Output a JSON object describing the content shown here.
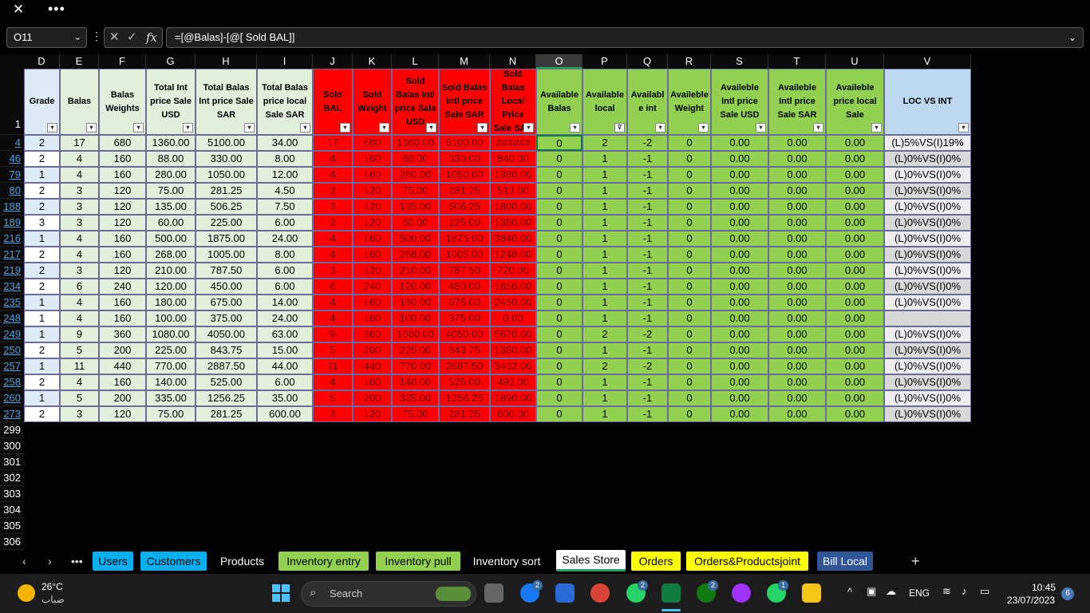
{
  "window": {
    "close_icon": "close-icon",
    "more_icon": "more-icon"
  },
  "formula_bar": {
    "cell_ref": "O11",
    "formula": "=[@Balas]-[@[ Sold BAL]]",
    "fx_label": "fx"
  },
  "columns": [
    {
      "letter": "D",
      "header": "Grade",
      "fill": "#ddebf7"
    },
    {
      "letter": "E",
      "header": "Balas",
      "fill": "#e2efda"
    },
    {
      "letter": "F",
      "header": "Balas Weights",
      "fill": "#e2efda"
    },
    {
      "letter": "G",
      "header": "Total Int price Sale USD",
      "fill": "#e2efda"
    },
    {
      "letter": "H",
      "header": "Total Balas Int price Sale SAR",
      "fill": "#e2efda"
    },
    {
      "letter": "I",
      "header": "Total Balas price local Sale SAR",
      "fill": "#e2efda"
    },
    {
      "letter": "J",
      "header": "Sold BAL",
      "fill": "#ff0000"
    },
    {
      "letter": "K",
      "header": "Sold Weight",
      "fill": "#ff0000"
    },
    {
      "letter": "L",
      "header": "Sold Balas Intl price Sale USD",
      "fill": "#ff0000"
    },
    {
      "letter": "M",
      "header": "Sold Balas Intl price Sale SAR",
      "fill": "#ff0000"
    },
    {
      "letter": "N",
      "header": "Sold Balas Local Price Sale SAR",
      "fill": "#ff0000"
    },
    {
      "letter": "O",
      "header": "Available Balas",
      "fill": "#92d050"
    },
    {
      "letter": "P",
      "header": "Available local",
      "fill": "#92d050"
    },
    {
      "letter": "Q",
      "header": "Availabl e int",
      "fill": "#92d050"
    },
    {
      "letter": "R",
      "header": "Availeble Weight",
      "fill": "#92d050"
    },
    {
      "letter": "S",
      "header": "Availeble Intl price Sale USD",
      "fill": "#92d050"
    },
    {
      "letter": "T",
      "header": "Availeble Intl price Sale SAR",
      "fill": "#92d050"
    },
    {
      "letter": "U",
      "header": "Availeble price local Sale",
      "fill": "#92d050"
    },
    {
      "letter": "V",
      "header": "LOC VS INT",
      "fill": "#bdd7ee"
    }
  ],
  "header_row_number": "1",
  "rows": [
    {
      "n": "4",
      "c": [
        "2",
        "17",
        "680",
        "1360.00",
        "5100.00",
        "34.00",
        "17",
        "680",
        "1360.00",
        "5100.00",
        "######",
        "0",
        "2",
        "-2",
        "0",
        "0.00",
        "0.00",
        "0.00",
        "(L)5%VS(I)19%"
      ]
    },
    {
      "n": "46",
      "c": [
        "2",
        "4",
        "160",
        "88.00",
        "330.00",
        "8.00",
        "4",
        "160",
        "88.00",
        "330.00",
        "840.00",
        "0",
        "1",
        "-1",
        "0",
        "0.00",
        "0.00",
        "0.00",
        "(L)0%VS(I)0%"
      ]
    },
    {
      "n": "79",
      "c": [
        "1",
        "4",
        "160",
        "280.00",
        "1050.00",
        "12.00",
        "4",
        "160",
        "280.00",
        "1050.00",
        "1380.00",
        "0",
        "1",
        "-1",
        "0",
        "0.00",
        "0.00",
        "0.00",
        "(L)0%VS(I)0%"
      ]
    },
    {
      "n": "80",
      "c": [
        "2",
        "3",
        "120",
        "75.00",
        "281.25",
        "4.50",
        "3",
        "120",
        "75.00",
        "281.25",
        "513.00",
        "0",
        "1",
        "-1",
        "0",
        "0.00",
        "0.00",
        "0.00",
        "(L)0%VS(I)0%"
      ]
    },
    {
      "n": "188",
      "c": [
        "2",
        "3",
        "120",
        "135.00",
        "506.25",
        "7.50",
        "3",
        "120",
        "135.00",
        "506.25",
        "1800.00",
        "0",
        "1",
        "-1",
        "0",
        "0.00",
        "0.00",
        "0.00",
        "(L)0%VS(I)0%"
      ]
    },
    {
      "n": "189",
      "c": [
        "3",
        "3",
        "120",
        "60.00",
        "225.00",
        "6.00",
        "3",
        "120",
        "60.00",
        "225.00",
        "1380.00",
        "0",
        "1",
        "-1",
        "0",
        "0.00",
        "0.00",
        "0.00",
        "(L)0%VS(I)0%"
      ]
    },
    {
      "n": "216",
      "c": [
        "1",
        "4",
        "160",
        "500.00",
        "1875.00",
        "24.00",
        "4",
        "160",
        "500.00",
        "1875.00",
        "3840.00",
        "0",
        "1",
        "-1",
        "0",
        "0.00",
        "0.00",
        "0.00",
        "(L)0%VS(I)0%"
      ]
    },
    {
      "n": "217",
      "c": [
        "2",
        "4",
        "160",
        "268.00",
        "1005.00",
        "8.00",
        "4",
        "160",
        "268.00",
        "1005.00",
        "1248.00",
        "0",
        "1",
        "-1",
        "0",
        "0.00",
        "0.00",
        "0.00",
        "(L)0%VS(I)0%"
      ]
    },
    {
      "n": "219",
      "c": [
        "2",
        "3",
        "120",
        "210.00",
        "787.50",
        "6.00",
        "3",
        "120",
        "210.00",
        "787.50",
        "720.00",
        "0",
        "1",
        "-1",
        "0",
        "0.00",
        "0.00",
        "0.00",
        "(L)0%VS(I)0%"
      ]
    },
    {
      "n": "234",
      "c": [
        "2",
        "6",
        "240",
        "120.00",
        "450.00",
        "6.00",
        "6",
        "240",
        "120.00",
        "450.00",
        "1656.00",
        "0",
        "1",
        "-1",
        "0",
        "0.00",
        "0.00",
        "0.00",
        "(L)0%VS(I)0%"
      ]
    },
    {
      "n": "235",
      "c": [
        "1",
        "4",
        "160",
        "180.00",
        "675.00",
        "14.00",
        "4",
        "160",
        "180.00",
        "675.00",
        "2450.00",
        "0",
        "1",
        "-1",
        "0",
        "0.00",
        "0.00",
        "0.00",
        "(L)0%VS(I)0%"
      ]
    },
    {
      "n": "248",
      "c": [
        "1",
        "4",
        "160",
        "100.00",
        "375.00",
        "24.00",
        "4",
        "160",
        "100.00",
        "375.00",
        "0.00",
        "0",
        "1",
        "-1",
        "0",
        "0.00",
        "0.00",
        "0.00",
        ""
      ]
    },
    {
      "n": "249",
      "c": [
        "1",
        "9",
        "360",
        "1080.00",
        "4050.00",
        "63.00",
        "9",
        "360",
        "1080.00",
        "4050.00",
        "5670.00",
        "0",
        "2",
        "-2",
        "0",
        "0.00",
        "0.00",
        "0.00",
        "(L)0%VS(I)0%"
      ]
    },
    {
      "n": "250",
      "c": [
        "2",
        "5",
        "200",
        "225.00",
        "843.75",
        "15.00",
        "5",
        "200",
        "225.00",
        "843.75",
        "1380.00",
        "0",
        "1",
        "-1",
        "0",
        "0.00",
        "0.00",
        "0.00",
        "(L)0%VS(I)0%"
      ]
    },
    {
      "n": "257",
      "c": [
        "1",
        "11",
        "440",
        "770.00",
        "2887.50",
        "44.00",
        "11",
        "440",
        "770.00",
        "2887.50",
        "3432.00",
        "0",
        "2",
        "-2",
        "0",
        "0.00",
        "0.00",
        "0.00",
        "(L)0%VS(I)0%"
      ]
    },
    {
      "n": "258",
      "c": [
        "2",
        "4",
        "160",
        "140.00",
        "525.00",
        "6.00",
        "4",
        "160",
        "140.00",
        "525.00",
        "492.00",
        "0",
        "1",
        "-1",
        "0",
        "0.00",
        "0.00",
        "0.00",
        "(L)0%VS(I)0%"
      ]
    },
    {
      "n": "260",
      "c": [
        "1",
        "5",
        "200",
        "335.00",
        "1256.25",
        "35.00",
        "5",
        "200",
        "335.00",
        "1256.25",
        "1890.00",
        "0",
        "1",
        "-1",
        "0",
        "0.00",
        "0.00",
        "0.00",
        "(L)0%VS(I)0%"
      ]
    },
    {
      "n": "273",
      "c": [
        "2",
        "3",
        "120",
        "75.00",
        "281.25",
        "600.00",
        "3",
        "120",
        "75.00",
        "281.25",
        "600.00",
        "0",
        "1",
        "-1",
        "0",
        "0.00",
        "0.00",
        "0.00",
        "(L)0%VS(I)0%"
      ]
    }
  ],
  "empty_rows": [
    "299",
    "300",
    "301",
    "302",
    "303",
    "304",
    "305",
    "306"
  ],
  "sheet_tabs": [
    {
      "label": "Users",
      "color": "#00b0f0"
    },
    {
      "label": "Customers",
      "color": "#00b0f0"
    },
    {
      "label": "Products",
      "color": ""
    },
    {
      "label": "Inventory entry",
      "color": "#92d050"
    },
    {
      "label": "Inventory pull",
      "color": "#92d050"
    },
    {
      "label": "Inventory sort",
      "color": ""
    },
    {
      "label": "Sales Store",
      "color": "#ffffff",
      "active": true
    },
    {
      "label": "Orders",
      "color": "#ffff00"
    },
    {
      "label": "Orders&Productsjoint",
      "color": "#ffff00"
    },
    {
      "label": "Bill Local",
      "color": "#2f5597"
    }
  ],
  "taskbar": {
    "weather_temp": "26°C",
    "weather_desc": "ضباب",
    "search_placeholder": "Search",
    "language": "ENG",
    "time": "10:45",
    "date": "23/07/2023",
    "notification_count": "6",
    "badges": {
      "facebook": "2",
      "whatsapp1": "2",
      "xbox": "2",
      "whatsapp2": "1"
    }
  }
}
